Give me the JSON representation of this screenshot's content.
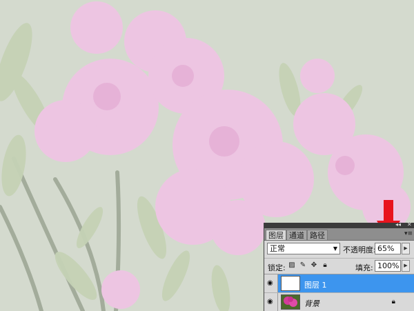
{
  "image": {
    "subject": "pink-azalea-flowers-photo"
  },
  "panel": {
    "tabs": [
      {
        "label": "图层",
        "active": true
      },
      {
        "label": "通道",
        "active": false
      },
      {
        "label": "路径",
        "active": false
      }
    ],
    "menu_icon": "panel-menu-icon",
    "blend_mode": "正常",
    "opacity_label": "不透明度:",
    "opacity_value": "65%",
    "lock_label": "锁定:",
    "lock_icons": [
      "lock-transparency-icon",
      "lock-brush-icon",
      "lock-move-icon",
      "lock-all-icon"
    ],
    "fill_label": "填充:",
    "fill_value": "100%",
    "layers": [
      {
        "name": "图层 1",
        "selected": true,
        "visible": true,
        "thumbnail": "white"
      },
      {
        "name": "背景",
        "selected": false,
        "visible": true,
        "thumbnail": "photo",
        "locked": true
      }
    ]
  },
  "annotation": {
    "type": "red-arrow",
    "color": "#e8141e",
    "points_to": "opacity-value"
  },
  "colors": {
    "selection": "#3d95ee",
    "panel_bg": "#d9d9d9",
    "tab_bar": "#8e8e8e",
    "title_bar": "#3b3b3b"
  }
}
